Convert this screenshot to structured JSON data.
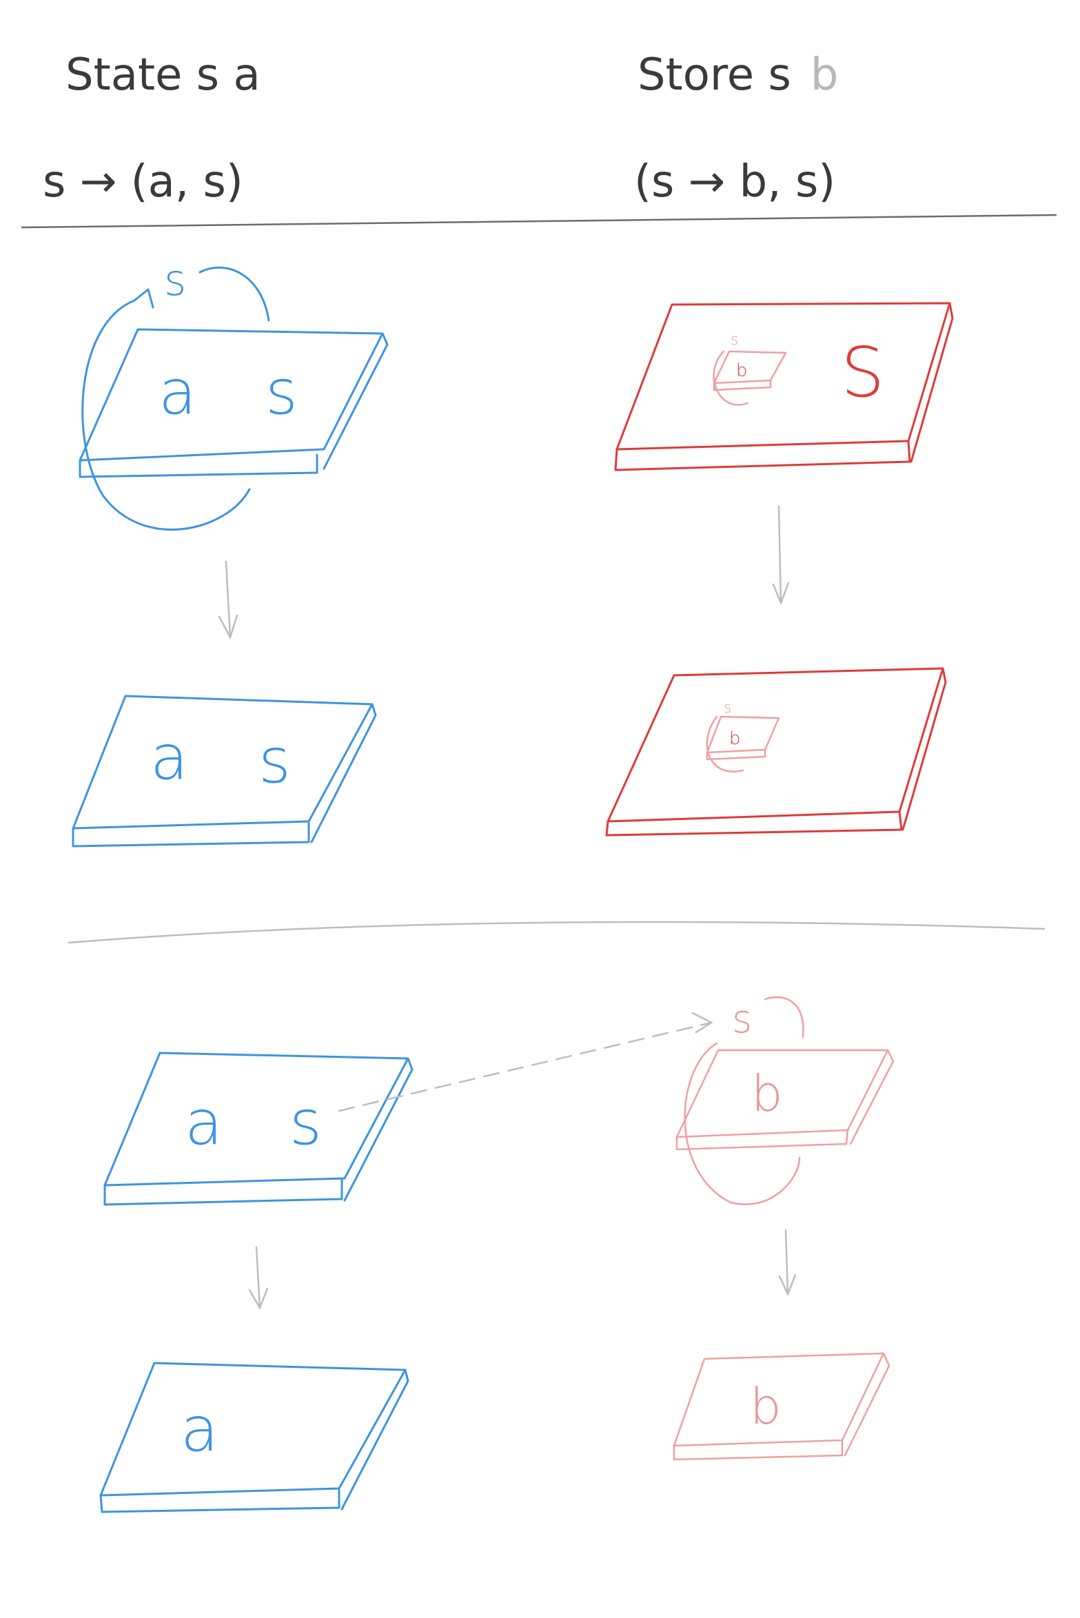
{
  "header": {
    "left_title": "State s a",
    "left_type": "s → (a, s)",
    "right_title": "Store s",
    "right_title_faint": "b",
    "right_type": "(s → b, s)"
  },
  "tiles": {
    "state_before": {
      "value": "a",
      "state": "s",
      "loop_label": "s"
    },
    "state_after": {
      "value": "a",
      "state": "s"
    },
    "store_before": {
      "inner_value": "b",
      "inner_loop_label": "s",
      "state": "S"
    },
    "store_after": {
      "inner_value": "b",
      "inner_loop_label": "s"
    },
    "bottom_state_before": {
      "value": "a",
      "state": "s"
    },
    "bottom_store_before": {
      "value": "b",
      "loop_label": "s"
    },
    "bottom_state_after": {
      "value": "a"
    },
    "bottom_store_after": {
      "value": "b"
    }
  },
  "colors": {
    "state": "#3e94de",
    "store": "#e03a3a",
    "store_faint": "#eea0a0",
    "arrow": "#bdbdbd",
    "divider": "#6c6c6c"
  }
}
